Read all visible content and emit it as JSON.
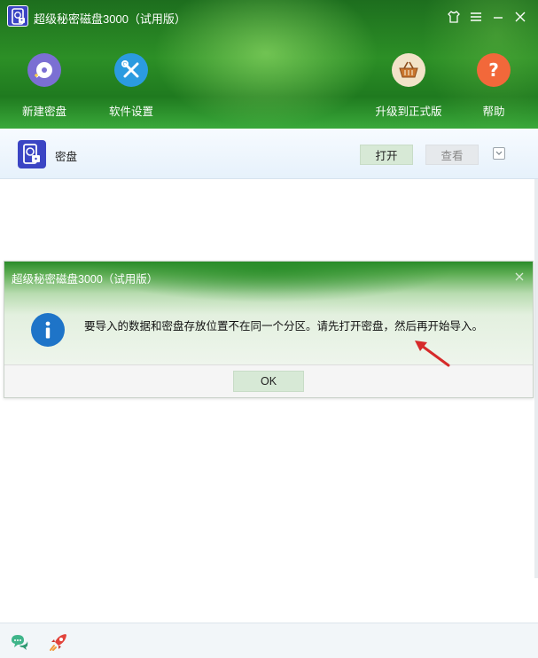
{
  "app": {
    "title": "超级秘密磁盘3000（试用版）"
  },
  "toolbar": {
    "new_disk": "新建密盘",
    "settings": "软件设置",
    "upgrade": "升级到正式版",
    "help": "帮助"
  },
  "disk": {
    "name": "密盘",
    "open_label": "打开",
    "view_label": "查看"
  },
  "dialog": {
    "title": "超级秘密磁盘3000（试用版）",
    "message": "要导入的数据和密盘存放位置不在同一个分区。请先打开密盘，然后再开始导入。",
    "ok_label": "OK"
  },
  "colors": {
    "header_green": "#2c8f26",
    "logo_blue": "#3b45c4",
    "info_blue": "#1e74c8",
    "button_green": "#d7e9d6",
    "arrow_red": "#d62a2a"
  },
  "icons": {
    "new_disk": "disk-plus-icon",
    "settings": "wrench-screwdriver-icon",
    "upgrade": "basket-icon",
    "help": "question-icon"
  }
}
